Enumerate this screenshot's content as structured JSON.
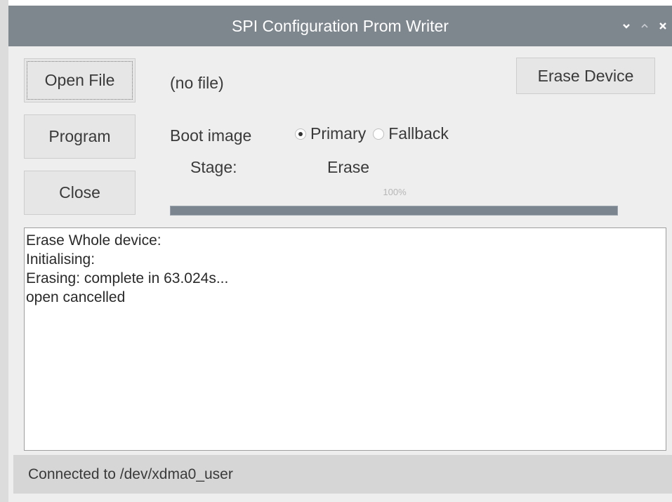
{
  "window": {
    "title": "SPI Configuration Prom Writer",
    "controls": {
      "minimize_icon": "chevron-down-icon",
      "maximize_icon": "chevron-up-icon",
      "close_icon": "close-icon"
    }
  },
  "buttons": {
    "open_file": "Open File",
    "program": "Program",
    "close": "Close",
    "erase_device": "Erase Device"
  },
  "file": {
    "name": "(no file)"
  },
  "boot_image": {
    "label": "Boot image",
    "options": [
      {
        "label": "Primary",
        "checked": true
      },
      {
        "label": "Fallback",
        "checked": false
      }
    ]
  },
  "stage": {
    "label": "Stage:",
    "value": "Erase"
  },
  "progress": {
    "text": "100%",
    "value": 1.0
  },
  "log": {
    "lines": [
      "Erase Whole device:",
      "Initialising:",
      "Erasing: complete in 63.024s...",
      "open cancelled"
    ]
  },
  "status": {
    "text": "Connected to /dev/xdma0_user"
  },
  "colors": {
    "titlebar": "#7e868e",
    "progress_fill": "#7b858f",
    "window_bg": "#eeeeee"
  }
}
